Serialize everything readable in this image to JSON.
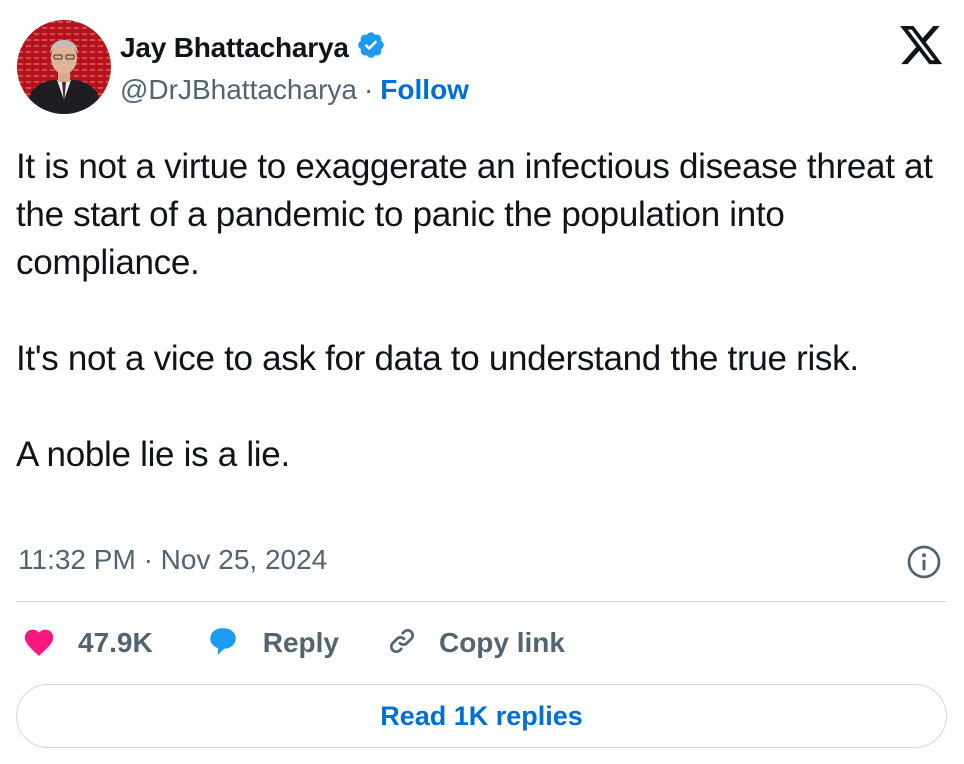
{
  "author": {
    "name": "Jay Bhattacharya",
    "handle": "@DrJBhattacharya",
    "separator": "·",
    "follow_label": "Follow",
    "verified": true
  },
  "tweet": {
    "paragraphs": [
      "It is not a virtue to exaggerate an infectious disease threat at the start of a pandemic to panic the population into compliance.",
      "It's not a vice to ask for data to understand the true risk.",
      "A noble lie is a lie."
    ],
    "time": "11:32 PM",
    "date_separator": "·",
    "date": "Nov 25, 2024"
  },
  "actions": {
    "like_count": "47.9K",
    "reply_label": "Reply",
    "copy_link_label": "Copy link",
    "read_replies_label": "Read 1K replies"
  },
  "icons": {
    "brand": "x-logo-icon",
    "verified": "verified-badge-icon",
    "info": "info-icon",
    "like": "heart-icon",
    "reply": "speech-bubble-icon",
    "copy": "link-icon"
  },
  "colors": {
    "link_blue": "#006fd6",
    "verified_blue": "#1d9bf0",
    "heart_pink": "#f91880",
    "secondary_text": "#536471",
    "divider": "#cfd9de"
  }
}
